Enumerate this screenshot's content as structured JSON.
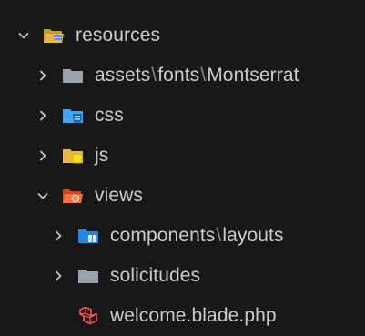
{
  "explorer": {
    "items": [
      {
        "label": "resources",
        "expanded": true,
        "depth": 0,
        "icon": "folder-resources-open-icon"
      },
      {
        "segments": [
          "assets",
          "fonts",
          "Montserrat"
        ],
        "separator": "\\",
        "expanded": false,
        "depth": 1,
        "icon": "folder-icon"
      },
      {
        "label": "css",
        "expanded": false,
        "depth": 1,
        "icon": "folder-css-icon"
      },
      {
        "label": "js",
        "expanded": false,
        "depth": 1,
        "icon": "folder-js-icon"
      },
      {
        "label": "views",
        "expanded": true,
        "depth": 1,
        "icon": "folder-views-open-icon"
      },
      {
        "segments": [
          "components",
          "layouts"
        ],
        "separator": "\\",
        "expanded": false,
        "depth": 2,
        "icon": "folder-components-icon"
      },
      {
        "label": "solicitudes",
        "expanded": false,
        "depth": 2,
        "icon": "folder-icon"
      },
      {
        "label": "welcome.blade.php",
        "depth": 2,
        "icon": "laravel-blade-icon"
      }
    ]
  },
  "colors": {
    "background": "#181818",
    "text": "#cccccc",
    "folder_yellow": "#e8b744",
    "folder_grey": "#9aa3ad",
    "css_blue": "#42a5f5",
    "views_orange": "#ff7043",
    "components_blue": "#1e88e5",
    "laravel_red": "#ff5252"
  }
}
